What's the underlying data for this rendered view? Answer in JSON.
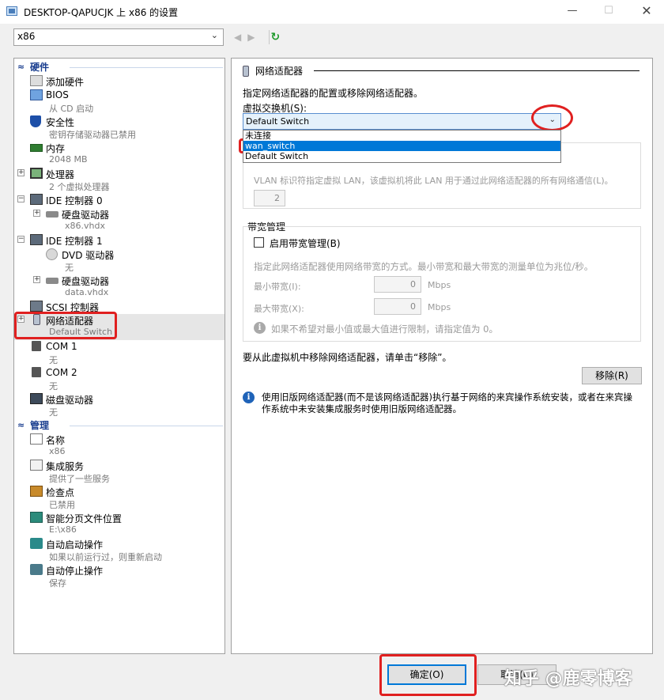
{
  "window": {
    "title": "DESKTOP-QAPUCJK 上 x86 的设置",
    "minimize": "—",
    "maximize": "☐",
    "close": "✕"
  },
  "vm_selector": {
    "value": "x86",
    "chevron": "⌄"
  },
  "toolbar": {
    "back": "◀",
    "forward": "▶",
    "refresh": "↻"
  },
  "tree": {
    "hardware_label": "硬件",
    "management_label": "管理",
    "caret": "≈",
    "nodes": [
      {
        "key": "add-hardware",
        "label": "添加硬件",
        "sub": "",
        "icon": "add-hardware-icon"
      },
      {
        "key": "bios",
        "label": "BIOS",
        "sub": "从 CD 启动",
        "icon": "bios-icon"
      },
      {
        "key": "security",
        "label": "安全性",
        "sub": "密钥存储驱动器已禁用",
        "icon": "shield-icon"
      },
      {
        "key": "memory",
        "label": "内存",
        "sub": "2048 MB",
        "icon": "memory-icon"
      },
      {
        "key": "processor",
        "label": "处理器",
        "sub": "2 个虚拟处理器",
        "icon": "cpu-icon"
      },
      {
        "key": "ide0",
        "label": "IDE 控制器 0",
        "sub": "",
        "icon": "ide-controller-icon"
      },
      {
        "key": "hdd0",
        "label": "硬盘驱动器",
        "sub": "x86.vhdx",
        "icon": "hard-disk-icon"
      },
      {
        "key": "ide1",
        "label": "IDE 控制器 1",
        "sub": "",
        "icon": "ide-controller-icon"
      },
      {
        "key": "dvd",
        "label": "DVD 驱动器",
        "sub": "无",
        "icon": "dvd-icon"
      },
      {
        "key": "hdd1",
        "label": "硬盘驱动器",
        "sub": "data.vhdx",
        "icon": "hard-disk-icon"
      },
      {
        "key": "scsi",
        "label": "SCSI 控制器",
        "sub": "",
        "icon": "scsi-icon"
      },
      {
        "key": "nic",
        "label": "网络适配器",
        "sub": "Default Switch",
        "icon": "network-adapter-icon"
      },
      {
        "key": "com1",
        "label": "COM 1",
        "sub": "无",
        "icon": "com-port-icon"
      },
      {
        "key": "com2",
        "label": "COM 2",
        "sub": "无",
        "icon": "com-port-icon"
      },
      {
        "key": "floppy",
        "label": "磁盘驱动器",
        "sub": "无",
        "icon": "floppy-icon"
      },
      {
        "key": "name",
        "label": "名称",
        "sub": "x86",
        "icon": "name-icon"
      },
      {
        "key": "integration",
        "label": "集成服务",
        "sub": "提供了一些服务",
        "icon": "integration-services-icon"
      },
      {
        "key": "checkpoints",
        "label": "检查点",
        "sub": "已禁用",
        "icon": "checkpoint-icon"
      },
      {
        "key": "paging",
        "label": "智能分页文件位置",
        "sub": "E:\\x86",
        "icon": "smart-paging-icon"
      },
      {
        "key": "autostart",
        "label": "自动启动操作",
        "sub": "如果以前运行过，则重新启动",
        "icon": "auto-start-icon"
      },
      {
        "key": "autostop",
        "label": "自动停止操作",
        "sub": "保存",
        "icon": "auto-stop-icon"
      }
    ],
    "expander_plus": "+"
  },
  "panel": {
    "header": "网络适配器",
    "description": "指定网络适配器的配置或移除网络适配器。",
    "switch_label": "虚拟交换机(S):",
    "switch_value": "Default Switch",
    "switch_chevron": "⌄",
    "switch_options": [
      "未连接",
      "wan_switch",
      "Default Switch"
    ],
    "vlan_text": "VLAN 标识符指定虚拟 LAN，该虚拟机将此 LAN 用于通过此网络适配器的所有网络通信(L)。",
    "vlan_value": "2",
    "bandwidth_group": "带宽管理",
    "bandwidth_checkbox": "启用带宽管理(B)",
    "bandwidth_desc": "指定此网络适配器使用网络带宽的方式。最小带宽和最大带宽的测量单位为兆位/秒。",
    "min_label": "最小带宽(I):",
    "min_value": "0",
    "max_label": "最大带宽(X):",
    "max_value": "0",
    "unit": "Mbps",
    "limit_hint": "如果不希望对最小值或最大值进行限制，请指定值为 0。",
    "remove_text": "要从此虚拟机中移除网络适配器，请单击“移除”。",
    "remove_button": "移除(R)",
    "legacy_info": "使用旧版网络适配器(而不是该网络适配器)执行基于网络的来宾操作系统安装，或者在来宾操作系统中未安装集成服务时使用旧版网络适配器。",
    "info_glyph": "i"
  },
  "footer": {
    "ok": "确定(O)",
    "cancel": "取消(C)"
  },
  "watermark": "知乎 @鹿零博客",
  "colors": {
    "accent": "#0078d7",
    "category": "#1a3e8f",
    "annotation": "#e02020"
  }
}
